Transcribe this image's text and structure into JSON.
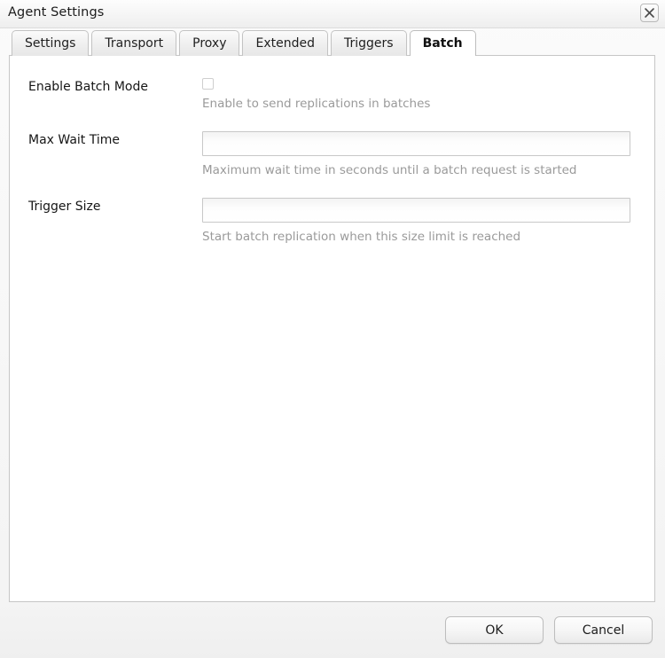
{
  "window": {
    "title": "Agent Settings",
    "close_icon": "close-icon"
  },
  "tabs": [
    {
      "label": "Settings",
      "active": false
    },
    {
      "label": "Transport",
      "active": false
    },
    {
      "label": "Proxy",
      "active": false
    },
    {
      "label": "Extended",
      "active": false
    },
    {
      "label": "Triggers",
      "active": false
    },
    {
      "label": "Batch",
      "active": true
    }
  ],
  "form": {
    "rows": [
      {
        "label": "Enable Batch Mode",
        "type": "checkbox",
        "checked": false,
        "hint": "Enable to send replications in batches"
      },
      {
        "label": "Max Wait Time",
        "type": "text",
        "value": "",
        "placeholder": "",
        "hint": "Maximum wait time in seconds until a batch request is started"
      },
      {
        "label": "Trigger Size",
        "type": "text",
        "value": "",
        "placeholder": "",
        "hint": "Start batch replication when this size limit is reached"
      }
    ]
  },
  "footer": {
    "ok_label": "OK",
    "cancel_label": "Cancel"
  },
  "colors": {
    "label_text": "#161616",
    "hint_text": "#9a9a9a",
    "panel_background": "#ffffff",
    "window_background": "#f0f0f0",
    "border": "#c6c6c6"
  }
}
